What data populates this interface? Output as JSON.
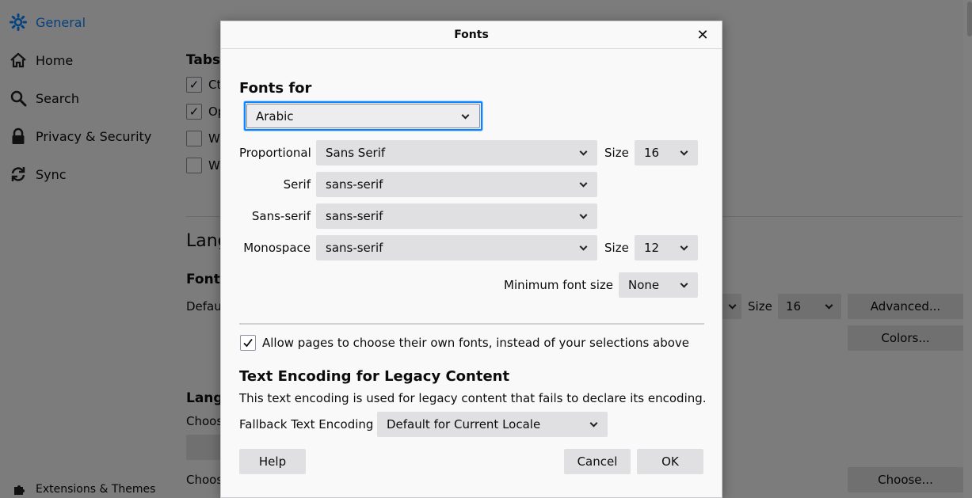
{
  "sidebar": {
    "items": [
      {
        "label": "General",
        "icon": "gear-icon",
        "selected": true
      },
      {
        "label": "Home",
        "icon": "home-icon"
      },
      {
        "label": "Search",
        "icon": "search-icon"
      },
      {
        "label": "Privacy & Security",
        "icon": "lock-icon"
      },
      {
        "label": "Sync",
        "icon": "sync-icon"
      }
    ],
    "extensions_label": "Extensions & Themes"
  },
  "background": {
    "tabs_heading": "Tabs",
    "cb1": "Ct",
    "cb2": "Op",
    "cb3": "W",
    "cb4": "W",
    "lang_heading": "Lang",
    "fonts_heading": "Font",
    "default_label": "Defau",
    "size_label": "Size",
    "size_value": "16",
    "advanced_button": "Advanced...",
    "colors_button": "Colors...",
    "lang2_heading": "Lang",
    "choose_text1": "Choos",
    "choose_text2": "Choos",
    "choose_button": "Choose..."
  },
  "dialog": {
    "title": "Fonts",
    "fonts_for_heading": "Fonts for",
    "fonts_for_value": "Arabic",
    "proportional_label": "Proportional",
    "proportional_value": "Sans Serif",
    "size_label": "Size",
    "proportional_size": "16",
    "serif_label": "Serif",
    "serif_value": "sans-serif",
    "sans_serif_label": "Sans-serif",
    "sans_serif_value": "sans-serif",
    "monospace_label": "Monospace",
    "monospace_value": "sans-serif",
    "monospace_size": "12",
    "min_font_size_label": "Minimum font size",
    "min_font_size_value": "None",
    "allow_pages_label": "Allow pages to choose their own fonts, instead of your selections above",
    "allow_pages_checked": true,
    "encoding_heading": "Text Encoding for Legacy Content",
    "encoding_desc": "This text encoding is used for legacy content that fails to declare its encoding.",
    "fallback_label": "Fallback Text Encoding",
    "fallback_value": "Default for Current Locale",
    "help_button": "Help",
    "cancel_button": "Cancel",
    "ok_button": "OK"
  },
  "colors": {
    "accent": "#0a84ff",
    "button": "#e0e0e2",
    "dialog_bg": "#f9f9fa"
  }
}
